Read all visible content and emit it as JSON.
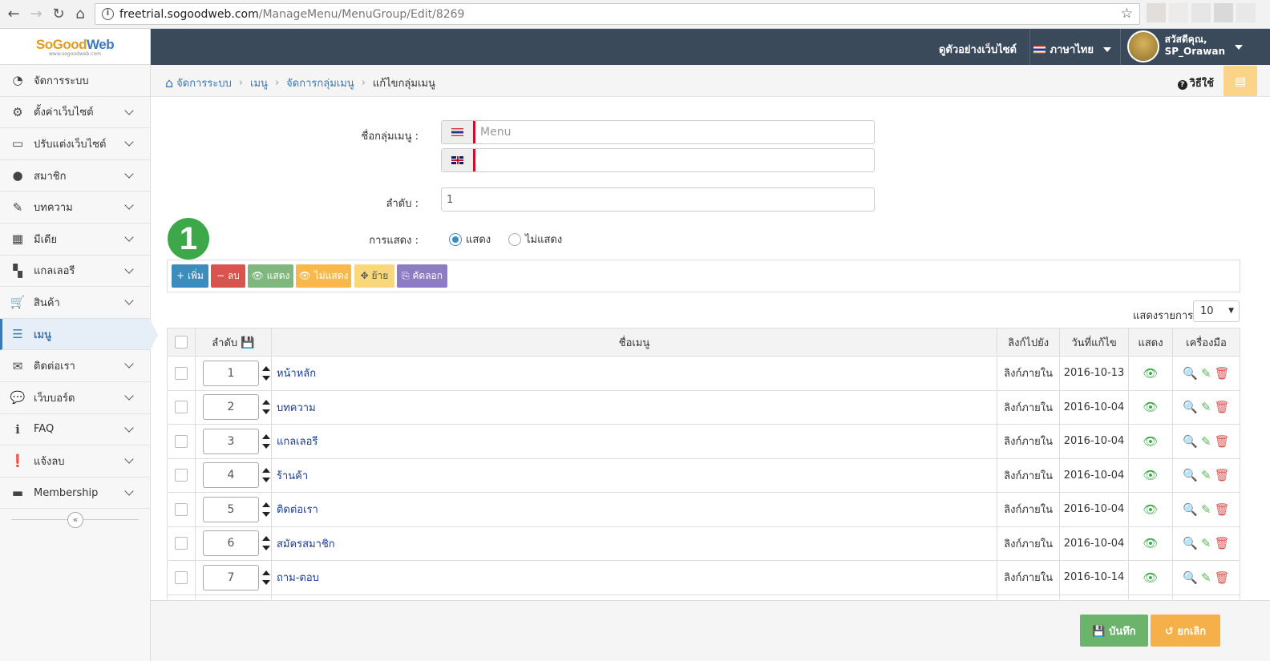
{
  "browser": {
    "url_host": "freetrial.sogoodweb.com",
    "url_path": "/ManageMenu/MenuGroup/Edit/8269"
  },
  "logo": {
    "brand_a": "SoGood",
    "brand_b": "Web",
    "tagline": "www.sogoodweb.com"
  },
  "topbar": {
    "demo_link": "ดูตัวอย่างเว็บไซต์",
    "language": "ภาษาไทย",
    "greeting": "สวัสดีคุณ,",
    "username": "SP_Orawan"
  },
  "sidebar": {
    "items": [
      {
        "label": "จัดการระบบ",
        "icon": "dashboard-icon"
      },
      {
        "label": "ตั้งค่าเว็บไซต์",
        "icon": "gear-icon"
      },
      {
        "label": "ปรับแต่งเว็บไซต์",
        "icon": "monitor-icon"
      },
      {
        "label": "สมาชิก",
        "icon": "user-icon"
      },
      {
        "label": "บทความ",
        "icon": "edit-icon"
      },
      {
        "label": "มีเดีย",
        "icon": "film-icon"
      },
      {
        "label": "แกลเลอรี",
        "icon": "grid-icon"
      },
      {
        "label": "สินค้า",
        "icon": "cart-icon"
      },
      {
        "label": "เมนู",
        "icon": "menu-icon"
      },
      {
        "label": "ติดต่อเรา",
        "icon": "envelope-icon"
      },
      {
        "label": "เว็บบอร์ด",
        "icon": "comments-icon"
      },
      {
        "label": "FAQ",
        "icon": "info-icon"
      },
      {
        "label": "แจ้งลบ",
        "icon": "alert-icon"
      },
      {
        "label": "Membership",
        "icon": "card-icon"
      }
    ]
  },
  "breadcrumb": {
    "items": [
      "จัดการระบบ",
      "เมนู",
      "จัดการกลุ่มเมนู"
    ],
    "current": "แก้ไขกลุ่มเมนู"
  },
  "help": {
    "label": "วิธีใช้"
  },
  "form": {
    "group_name_label": "ชื่อกลุ่มเมนู :",
    "group_name_th_placeholder": "Menu",
    "group_name_en_value": "",
    "order_label": "ลำดับ :",
    "order_value": "1",
    "display_label": "การแสดง :",
    "display_show": "แสดง",
    "display_hide": "ไม่แสดง"
  },
  "step_badge": "1",
  "toolbar": {
    "add": "+ เพิ่ม",
    "delete": "− ลบ",
    "show": "👁 แสดง",
    "hide": "👁 ไม่แสดง",
    "move": "✥ ย้าย",
    "copy": "⎘ คัดลอก"
  },
  "colors": {
    "add": "#3c8dbc",
    "delete": "#d9534f",
    "show": "#7fb77e",
    "hide": "#f6b94a",
    "move": "#fad77a",
    "copy": "#8e7cc3",
    "save": "#6cb36b",
    "cancel": "#f5b04a"
  },
  "pagesize": {
    "label": "แสดงรายการ",
    "value": "10"
  },
  "table": {
    "headers": {
      "order": "ลำดับ",
      "name": "ชื่อเมนู",
      "link": "ลิงก์ไปยัง",
      "date": "วันที่แก้ไข",
      "show": "แสดง",
      "tools": "เครื่องมือ"
    },
    "rows": [
      {
        "order": "1",
        "name": "หน้าหลัก",
        "link": "ลิงก์ภายใน",
        "date": "2016-10-13"
      },
      {
        "order": "2",
        "name": "บทความ",
        "link": "ลิงก์ภายใน",
        "date": "2016-10-04"
      },
      {
        "order": "3",
        "name": "แกลเลอรี",
        "link": "ลิงก์ภายใน",
        "date": "2016-10-04"
      },
      {
        "order": "4",
        "name": "ร้านค้า",
        "link": "ลิงก์ภายใน",
        "date": "2016-10-04"
      },
      {
        "order": "5",
        "name": "ติดต่อเรา",
        "link": "ลิงก์ภายใน",
        "date": "2016-10-04"
      },
      {
        "order": "6",
        "name": "สมัครสมาชิก",
        "link": "ลิงก์ภายใน",
        "date": "2016-10-04"
      },
      {
        "order": "7",
        "name": "ถาม-ตอบ",
        "link": "ลิงก์ภายใน",
        "date": "2016-10-14"
      }
    ]
  },
  "footer": {
    "save": "บันทึก",
    "cancel": "ยกเลิก"
  }
}
